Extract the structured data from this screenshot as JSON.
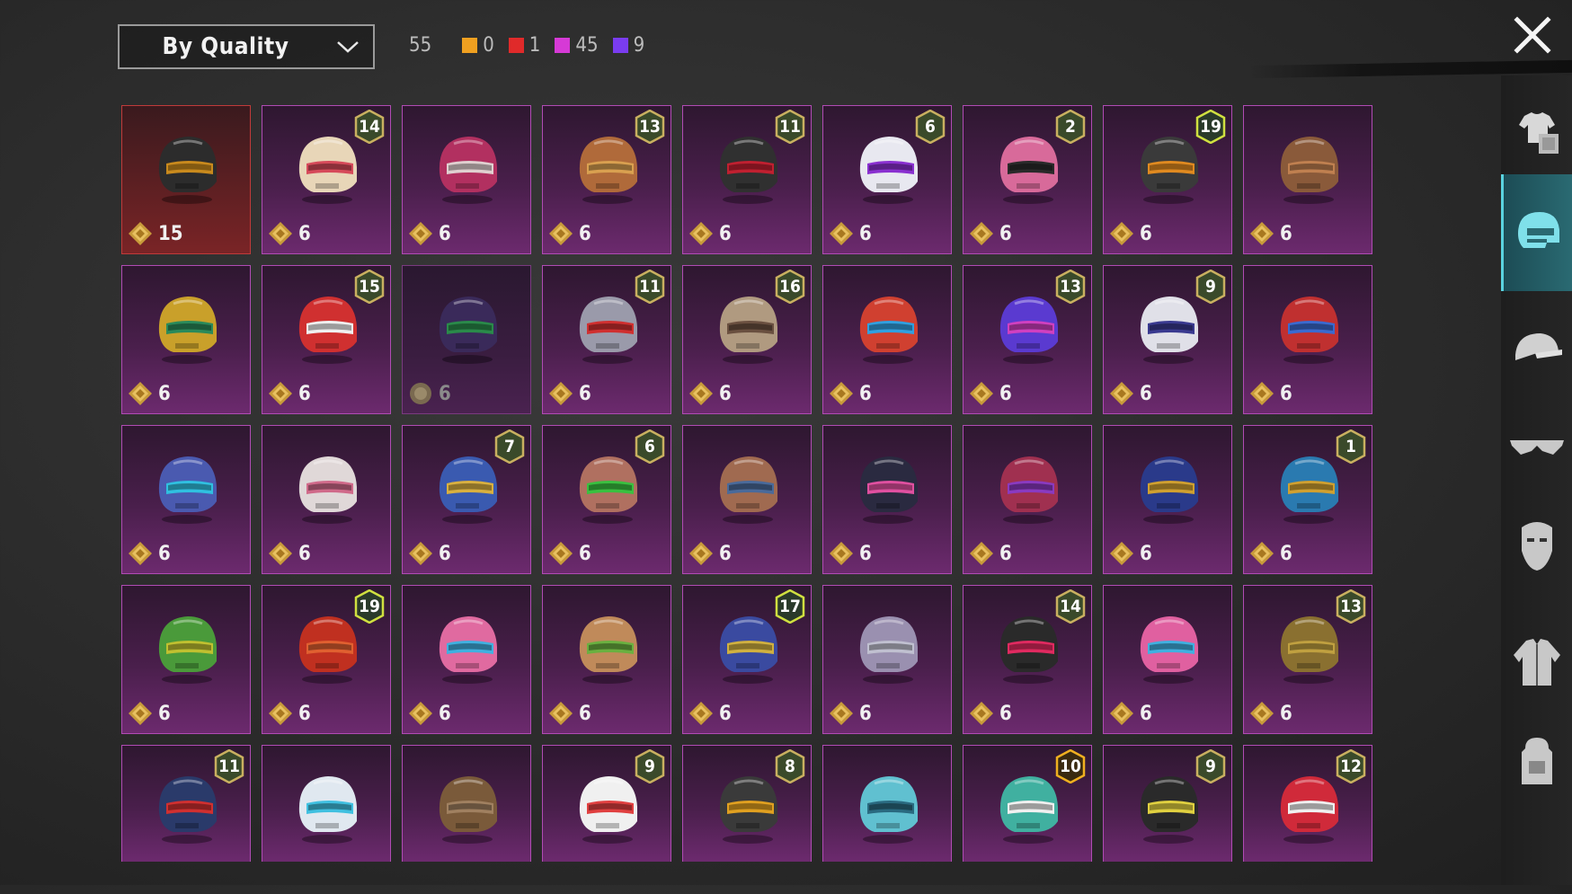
{
  "filter": {
    "label": "By Quality"
  },
  "counts": {
    "total": "55",
    "qualities": [
      {
        "color": "#f0a020",
        "value": "0"
      },
      {
        "color": "#e02a2a",
        "value": "1"
      },
      {
        "color": "#d63ad6",
        "value": "45"
      },
      {
        "color": "#7a3cf0",
        "value": "9"
      }
    ]
  },
  "sidebar": [
    {
      "name": "outfit-tab",
      "icon": "outfit-icon"
    },
    {
      "name": "helmet-tab",
      "icon": "helmet-icon",
      "active": true
    },
    {
      "name": "hat-tab",
      "icon": "cap-icon"
    },
    {
      "name": "glasses-tab",
      "icon": "glasses-icon"
    },
    {
      "name": "mask-tab",
      "icon": "mask-icon"
    },
    {
      "name": "jacket-tab",
      "icon": "jacket-icon"
    },
    {
      "name": "backpack-tab",
      "icon": "backpack-icon"
    }
  ],
  "items": [
    {
      "price": "15",
      "level": "",
      "color": "#2c2c2c",
      "accent": "#c98a1d",
      "style": "legend"
    },
    {
      "price": "6",
      "level": "14",
      "color": "#e8d6b8",
      "accent": "#d64a5a",
      "style": ""
    },
    {
      "price": "6",
      "level": "",
      "color": "#b23060",
      "accent": "#e0d0d0",
      "style": ""
    },
    {
      "price": "6",
      "level": "13",
      "color": "#b06a3a",
      "accent": "#d9a050",
      "style": ""
    },
    {
      "price": "6",
      "level": "11",
      "color": "#303030",
      "accent": "#c02030",
      "style": ""
    },
    {
      "price": "6",
      "level": "6",
      "color": "#e8e8f0",
      "accent": "#8a30d0",
      "style": ""
    },
    {
      "price": "6",
      "level": "2",
      "color": "#d86a9a",
      "accent": "#2a2a2a",
      "style": ""
    },
    {
      "price": "6",
      "level": "19",
      "color": "#3a3a3a",
      "accent": "#e08a20",
      "style": ""
    },
    {
      "price": "6",
      "level": "",
      "color": "#8a5a3a",
      "accent": "#c08050",
      "style": ""
    },
    {
      "price": "6",
      "level": "",
      "color": "#c9a02a",
      "accent": "#2a8a5a",
      "style": ""
    },
    {
      "price": "6",
      "level": "15",
      "color": "#d03030",
      "accent": "#f0f0f0",
      "style": ""
    },
    {
      "price": "6",
      "level": "",
      "color": "#3a2a5a",
      "accent": "#2a8a4a",
      "style": "dim"
    },
    {
      "price": "6",
      "level": "11",
      "color": "#9a9aaa",
      "accent": "#d03030",
      "style": ""
    },
    {
      "price": "6",
      "level": "16",
      "color": "#b09a80",
      "accent": "#6a5040",
      "style": ""
    },
    {
      "price": "6",
      "level": "",
      "color": "#d04030",
      "accent": "#30a0e0",
      "style": ""
    },
    {
      "price": "6",
      "level": "13",
      "color": "#5a3ad0",
      "accent": "#d040c0",
      "style": ""
    },
    {
      "price": "6",
      "level": "9",
      "color": "#e0e0e8",
      "accent": "#3a3a90",
      "style": ""
    },
    {
      "price": "6",
      "level": "",
      "color": "#c03030",
      "accent": "#3a6ad0",
      "style": ""
    },
    {
      "price": "6",
      "level": "",
      "color": "#4a5ab0",
      "accent": "#30c0e0",
      "style": ""
    },
    {
      "price": "6",
      "level": "",
      "color": "#e0d8d8",
      "accent": "#d06a8a",
      "style": ""
    },
    {
      "price": "6",
      "level": "7",
      "color": "#3a5ab0",
      "accent": "#d9b040",
      "style": ""
    },
    {
      "price": "6",
      "level": "6",
      "color": "#b07060",
      "accent": "#3ac040",
      "style": ""
    },
    {
      "price": "6",
      "level": "",
      "color": "#a06a50",
      "accent": "#4a6a9a",
      "style": ""
    },
    {
      "price": "6",
      "level": "",
      "color": "#2a2a40",
      "accent": "#e050a0",
      "style": ""
    },
    {
      "price": "6",
      "level": "",
      "color": "#a03050",
      "accent": "#8a3ac0",
      "style": ""
    },
    {
      "price": "6",
      "level": "",
      "color": "#2a3a8a",
      "accent": "#d0a030",
      "style": ""
    },
    {
      "price": "6",
      "level": "1",
      "color": "#2a7ab0",
      "accent": "#d0a030",
      "style": ""
    },
    {
      "price": "6",
      "level": "",
      "color": "#4a9a3a",
      "accent": "#c0c030",
      "style": ""
    },
    {
      "price": "6",
      "level": "19",
      "color": "#c03020",
      "accent": "#e06030",
      "style": ""
    },
    {
      "price": "6",
      "level": "",
      "color": "#e06aa0",
      "accent": "#40b0e0",
      "style": ""
    },
    {
      "price": "6",
      "level": "",
      "color": "#c08a5a",
      "accent": "#6ab040",
      "style": ""
    },
    {
      "price": "6",
      "level": "17",
      "color": "#3a4aa0",
      "accent": "#d0b040",
      "style": ""
    },
    {
      "price": "6",
      "level": "",
      "color": "#9a90b0",
      "accent": "#c0c0d0",
      "style": ""
    },
    {
      "price": "6",
      "level": "14",
      "color": "#2a2a2a",
      "accent": "#e02a60",
      "style": ""
    },
    {
      "price": "6",
      "level": "",
      "color": "#e060a0",
      "accent": "#40b0e0",
      "style": ""
    },
    {
      "price": "6",
      "level": "13",
      "color": "#8a7030",
      "accent": "#c0a040",
      "style": ""
    },
    {
      "price": "",
      "level": "11",
      "color": "#2a3a6a",
      "accent": "#d03030",
      "style": "cut"
    },
    {
      "price": "",
      "level": "",
      "color": "#e0e8f0",
      "accent": "#40c0e0",
      "style": "cut"
    },
    {
      "price": "",
      "level": "",
      "color": "#7a5a3a",
      "accent": "#a08060",
      "style": "cut"
    },
    {
      "price": "",
      "level": "9",
      "color": "#f0f0f0",
      "accent": "#e04040",
      "style": "cut"
    },
    {
      "price": "",
      "level": "8",
      "color": "#3a3a3a",
      "accent": "#e0a020",
      "style": "cut"
    },
    {
      "price": "",
      "level": "",
      "color": "#60c0d0",
      "accent": "#2a6a80",
      "style": "cut"
    },
    {
      "price": "",
      "level": "10",
      "color": "#40b0a0",
      "accent": "#f0f0f0",
      "style": "cut"
    },
    {
      "price": "",
      "level": "9",
      "color": "#2a2a2a",
      "accent": "#e0d040",
      "style": "cut"
    },
    {
      "price": "",
      "level": "12",
      "color": "#d02a3a",
      "accent": "#f0f0f0",
      "style": "cut"
    }
  ]
}
